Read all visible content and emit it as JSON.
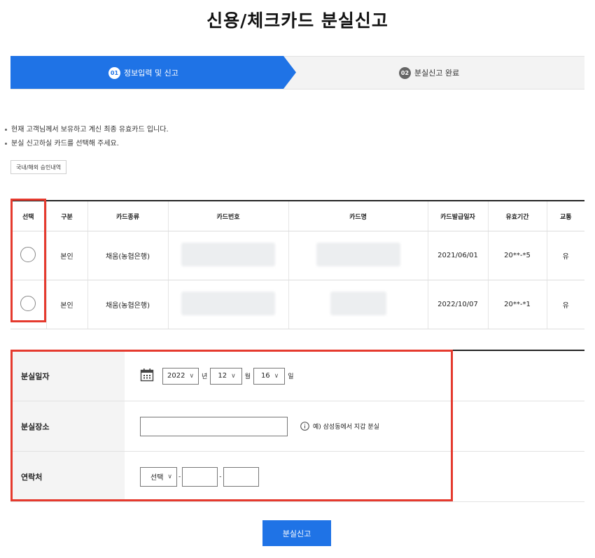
{
  "page_title": "신용/체크카드 분실신고",
  "steps": [
    {
      "num": "01",
      "label": "정보입력 및 신고",
      "active": true
    },
    {
      "num": "02",
      "label": "분실신고 완료",
      "active": false
    }
  ],
  "notes": [
    "현재 고객님께서 보유하고 계신 최종 유효카드 입니다.",
    "분실 신고하실 카드를 선택해 주세요."
  ],
  "history_button": "국내/해외 승인내역",
  "table": {
    "headers": [
      "선택",
      "구분",
      "카드종류",
      "카드번호",
      "카드명",
      "카드발급일자",
      "유효기간",
      "교통"
    ],
    "rows": [
      {
        "type": "본인",
        "kind": "채움(농협은행)",
        "issue_date": "2021/06/01",
        "expiry": "20**-*5",
        "transit": "유"
      },
      {
        "type": "본인",
        "kind": "채움(농협은행)",
        "issue_date": "2022/10/07",
        "expiry": "20**-*1",
        "transit": "유"
      }
    ]
  },
  "form": {
    "loss_date": {
      "label": "분실일자",
      "year": "2022",
      "year_unit": "년",
      "month": "12",
      "month_unit": "월",
      "day": "16",
      "day_unit": "일"
    },
    "loss_place": {
      "label": "분실장소",
      "value": "",
      "hint": "예) 삼성동에서 지갑 분실"
    },
    "contact": {
      "label": "연락처",
      "prefix": "선택",
      "sep": "-"
    }
  },
  "submit_button": "분실신고",
  "colors": {
    "primary": "#1f73e6",
    "highlight": "#e53a2e"
  }
}
